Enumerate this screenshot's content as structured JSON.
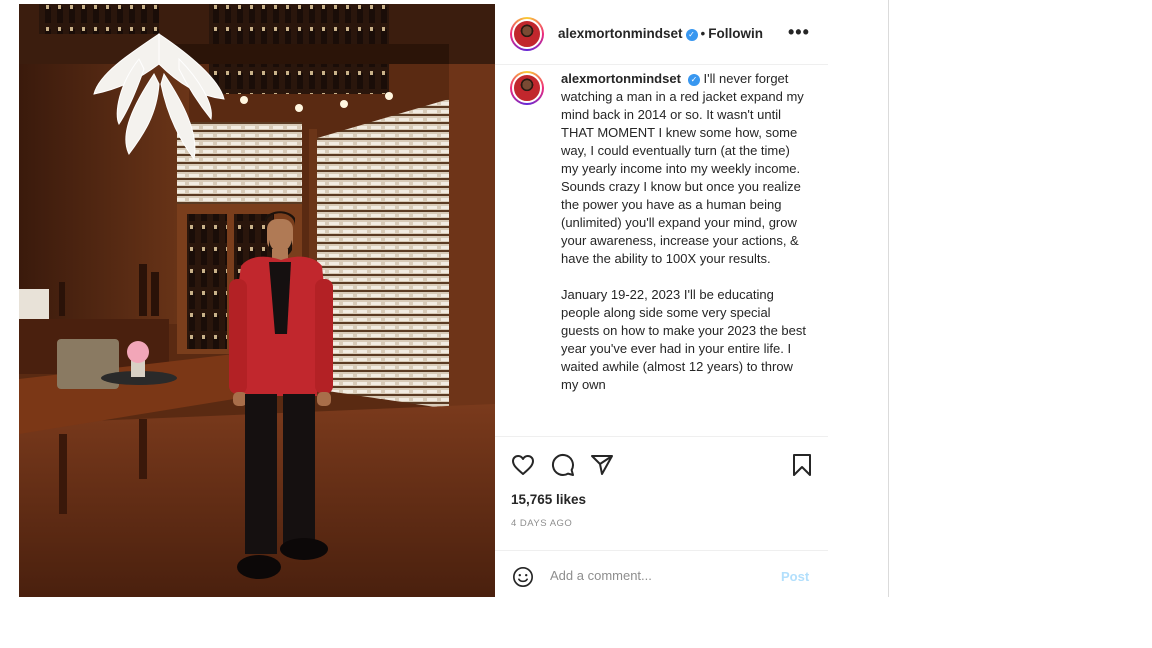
{
  "post": {
    "username": "alexmortonmindset",
    "follow_status": "Followin",
    "more_label": "•••",
    "caption_paragraph_1": "I'll never forget watching a man in a red jacket expand my mind back in 2014 or so. It wasn't until THAT MOMENT I knew some how, some way, I could eventually turn (at the time) my yearly income into my weekly income. Sounds crazy I know but once you realize the power you have as a human being (unlimited) you'll expand your mind, grow your awareness, increase your actions, & have the ability to 100X your results.",
    "caption_paragraph_2": "January 19-22, 2023 I'll be educating people along side some very special guests on how to make your 2023 the best year you've ever had in your entire life. I waited awhile (almost 12 years) to throw my own",
    "likes": "15,765 likes",
    "time_ago": "4 DAYS AGO",
    "comment_placeholder": "Add a comment...",
    "post_label": "Post"
  },
  "icons": {
    "verified": "verified-badge",
    "like": "heart-icon",
    "comment": "comment-icon",
    "share": "paper-plane-icon",
    "save": "bookmark-icon",
    "emoji": "smiley-icon"
  },
  "colors": {
    "jacket": "#c1272d",
    "verified": "#3897f0",
    "post_button": "#b2dffc"
  }
}
